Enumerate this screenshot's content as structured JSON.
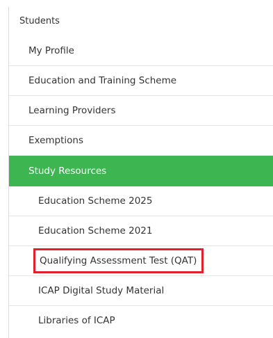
{
  "sidebar": {
    "title": "Students",
    "items": [
      {
        "label": "My Profile"
      },
      {
        "label": "Education and Training Scheme"
      },
      {
        "label": "Learning Providers"
      },
      {
        "label": "Exemptions"
      },
      {
        "label": "Study Resources"
      }
    ],
    "subitems": [
      {
        "label": "Education Scheme 2025"
      },
      {
        "label": "Education Scheme 2021"
      },
      {
        "label": "Qualifying Assessment Test (QAT)"
      },
      {
        "label": "ICAP Digital Study Material"
      },
      {
        "label": "Libraries of ICAP"
      }
    ],
    "active_color": "#3db551",
    "highlight_color": "#e0202a"
  }
}
